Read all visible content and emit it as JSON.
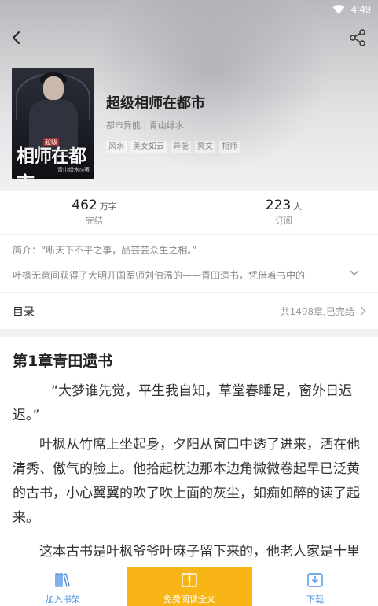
{
  "statusbar": {
    "time": "4:49"
  },
  "book": {
    "title": "超级相师在都市",
    "meta": "都市异能 | 青山绿水",
    "tags": [
      "风水",
      "美女如云",
      "异能",
      "爽文",
      "相师"
    ],
    "cover": {
      "title": "相师在都市",
      "badge": "超级",
      "author": "青山绿水◎著"
    }
  },
  "stats": {
    "words": {
      "value": "462",
      "unit": "万字",
      "label": "完结"
    },
    "subscribers": {
      "value": "223",
      "unit": "人",
      "label": "订阅"
    }
  },
  "intro": {
    "line1": "简介：“断天下不平之事，品芸芸众生之相。”",
    "line2": "叶枫无意间获得了大明开国军师刘伯温的——青田遗书，凭借着书中的"
  },
  "toc": {
    "label": "目录",
    "info": "共1498章,已完结"
  },
  "chapter": {
    "title": "第1章青田遗书",
    "paragraphs": [
      "“大梦谁先觉，平生我自知，草堂春睡足，窗外日迟迟。”",
      "叶枫从竹席上坐起身，夕阳从窗口中透了进来，洒在他清秀、傲气的脸上。他拾起枕边那本边角微微卷起早已泛黄的古书，小心翼翼的吹了吹上面的灰尘，如痴如醉的读了起来。",
      "这本古书是叶枫爷爷叶麻子留下来的，他老人家是十里"
    ]
  },
  "bottombar": {
    "shelf_label": "加入书架",
    "read_label": "免费阅读全文",
    "download_label": "下载"
  },
  "colors": {
    "accent": "#f9b516",
    "link": "#4a90e2"
  }
}
